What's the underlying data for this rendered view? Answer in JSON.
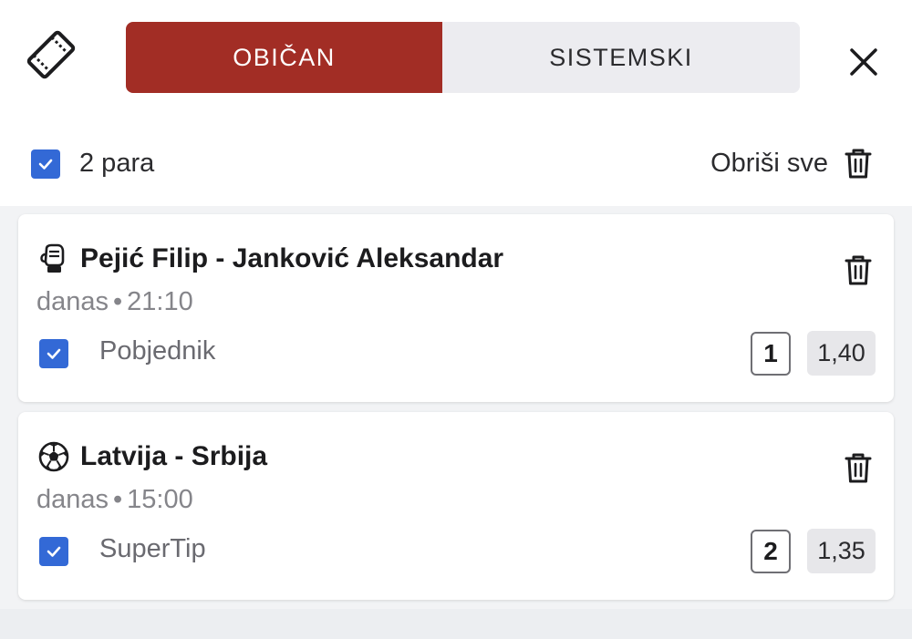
{
  "header": {
    "tabs": [
      {
        "label": "OBIČAN",
        "active": true
      },
      {
        "label": "SISTEMSKI",
        "active": false
      }
    ],
    "icons": {
      "ticket": "ticket-icon",
      "close": "close-icon"
    },
    "accent_color": "#a22d25"
  },
  "selection": {
    "count_label": "2 para",
    "delete_all_label": "Obriši sve",
    "checked": true
  },
  "bets": [
    {
      "sport_icon": "boxing-glove-icon",
      "title": "Pejić Filip - Janković Aleksandar",
      "day": "danas",
      "time": "21:10",
      "market": "Pobjednik",
      "outcome": "1",
      "odds": "1,40",
      "checked": true
    },
    {
      "sport_icon": "soccer-ball-icon",
      "title": "Latvija - Srbija",
      "day": "danas",
      "time": "15:00",
      "market": "SuperTip",
      "outcome": "2",
      "odds": "1,35",
      "checked": true
    }
  ],
  "colors": {
    "checkbox": "#3369d6",
    "muted_text": "#85858a"
  }
}
